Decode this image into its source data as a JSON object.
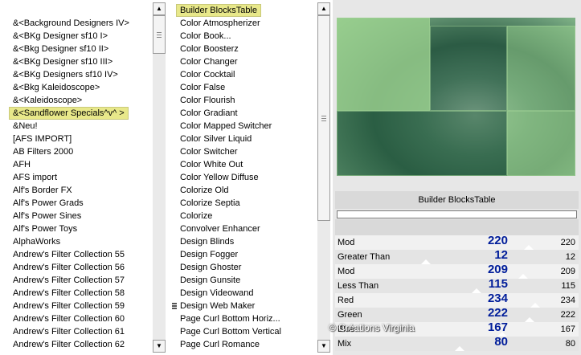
{
  "left_list": {
    "items": [
      "&<Background Designers IV>",
      "&<BKg Designer sf10 I>",
      "&<Bkg Designer sf10 II>",
      "&<BKg Designer sf10 III>",
      "&<BKg Designers sf10 IV>",
      "&<Bkg Kaleidoscope>",
      "&<Kaleidoscope>",
      "&<Sandflower Specials^v^ >",
      "&Neu!",
      "[AFS IMPORT]",
      "AB Filters 2000",
      "AFH",
      "AFS import",
      "Alf's Border FX",
      "Alf's Power Grads",
      "Alf's Power Sines",
      "Alf's Power Toys",
      "AlphaWorks",
      "Andrew's Filter Collection 55",
      "Andrew's Filter Collection 56",
      "Andrew's Filter Collection 57",
      "Andrew's Filter Collection 58",
      "Andrew's Filter Collection 59",
      "Andrew's Filter Collection 60",
      "Andrew's Filter Collection 61",
      "Andrew's Filter Collection 62"
    ],
    "selected_index": 7
  },
  "mid_list": {
    "items": [
      "Builder BlocksTable",
      "Color Atmospherizer",
      "Color Book...",
      "Color Boosterz",
      "Color Changer",
      "Color Cocktail",
      "Color False",
      "Color Flourish",
      "Color Gradiant",
      "Color Mapped Switcher",
      "Color Silver Liquid",
      "Color Switcher",
      "Color White Out",
      "Color Yellow Diffuse",
      "Colorize Old",
      "Colorize Septia",
      "Colorize",
      "Convolver Enhancer",
      "Design Blinds",
      "Design Fogger",
      "Design Ghoster",
      "Design Gunsite",
      "Design Videowand",
      "Design Web Maker",
      "Page Curl Bottom Horiz...",
      "Page Curl Bottom Vertical",
      "Page Curl Romance"
    ],
    "selected_index": 0,
    "grip_index": 23
  },
  "filter_title": "Builder BlocksTable",
  "progress_value": 0,
  "params": [
    {
      "label": "Mod",
      "value": "220",
      "small": "220",
      "fraction": 0.863
    },
    {
      "label": "Greater Than",
      "value": "12",
      "small": "12",
      "fraction": 0.047
    },
    {
      "label": "Mod",
      "value": "209",
      "small": "209",
      "fraction": 0.82
    },
    {
      "label": "Less Than",
      "value": "115",
      "small": "115",
      "fraction": 0.451
    },
    {
      "label": "Red",
      "value": "234",
      "small": "234",
      "fraction": 0.918
    },
    {
      "label": "Green",
      "value": "222",
      "small": "222",
      "fraction": 0.871
    },
    {
      "label": "Blue",
      "value": "167",
      "small": "167",
      "fraction": 0.655
    },
    {
      "label": "Mix",
      "value": "80",
      "small": "80",
      "fraction": 0.314
    }
  ],
  "watermark": "© Créations Virginia",
  "icons": {
    "scroll_up": "triangle-up",
    "scroll_down": "triangle-down"
  },
  "colors": {
    "highlight": "#e8e88a",
    "value_text": "#001d9a"
  }
}
